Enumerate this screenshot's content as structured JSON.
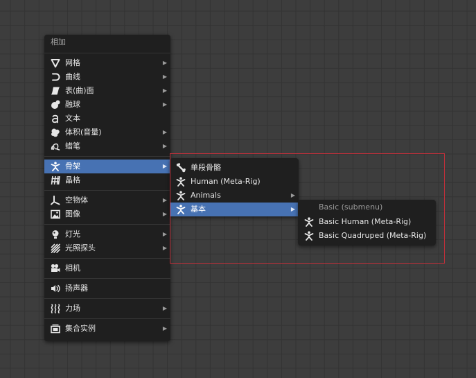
{
  "main_menu": {
    "title": "相加",
    "items": [
      {
        "label": "网格",
        "icon": "mesh-icon",
        "submenu": true
      },
      {
        "label": "曲线",
        "icon": "curve-icon",
        "submenu": true
      },
      {
        "label": "表(曲)面",
        "icon": "surface-icon",
        "submenu": true
      },
      {
        "label": "融球",
        "icon": "metaball-icon",
        "submenu": true
      },
      {
        "label": "文本",
        "icon": "text-icon",
        "submenu": false
      },
      {
        "label": "体积(音量)",
        "icon": "volume-icon",
        "submenu": true
      },
      {
        "label": "蜡笔",
        "icon": "grease-pencil-icon",
        "submenu": true
      },
      {
        "label": "骨架",
        "icon": "armature-icon",
        "submenu": true,
        "active": true
      },
      {
        "label": "晶格",
        "icon": "lattice-icon",
        "submenu": false
      },
      {
        "label": "空物体",
        "icon": "empty-icon",
        "submenu": true
      },
      {
        "label": "图像",
        "icon": "image-icon",
        "submenu": true
      },
      {
        "label": "灯光",
        "icon": "light-icon",
        "submenu": true
      },
      {
        "label": "光照探头",
        "icon": "light-probe-icon",
        "submenu": true
      },
      {
        "label": "相机",
        "icon": "camera-icon",
        "submenu": false
      },
      {
        "label": "扬声器",
        "icon": "speaker-icon",
        "submenu": false
      },
      {
        "label": "力场",
        "icon": "force-field-icon",
        "submenu": true
      },
      {
        "label": "集合实例",
        "icon": "collection-instance-icon",
        "submenu": true
      }
    ]
  },
  "armature_menu": {
    "items": [
      {
        "label": "单段骨骼",
        "icon": "bone-icon",
        "submenu": false
      },
      {
        "label": "Human (Meta-Rig)",
        "icon": "armature-icon",
        "submenu": false
      },
      {
        "label": "Animals",
        "icon": "armature-icon",
        "submenu": true
      },
      {
        "label": "基本",
        "icon": "armature-icon",
        "submenu": true,
        "active": true
      }
    ]
  },
  "basic_menu": {
    "title": "Basic (submenu)",
    "items": [
      {
        "label": "Basic Human (Meta-Rig)",
        "icon": "armature-icon"
      },
      {
        "label": "Basic Quadruped (Meta-Rig)",
        "icon": "armature-icon"
      }
    ]
  },
  "submenu_arrow": "▶",
  "colors": {
    "background": "#3d3d3d",
    "menu": "#1f1f1f",
    "highlight": "#4772b3",
    "annotation_box": "#c0303a"
  }
}
